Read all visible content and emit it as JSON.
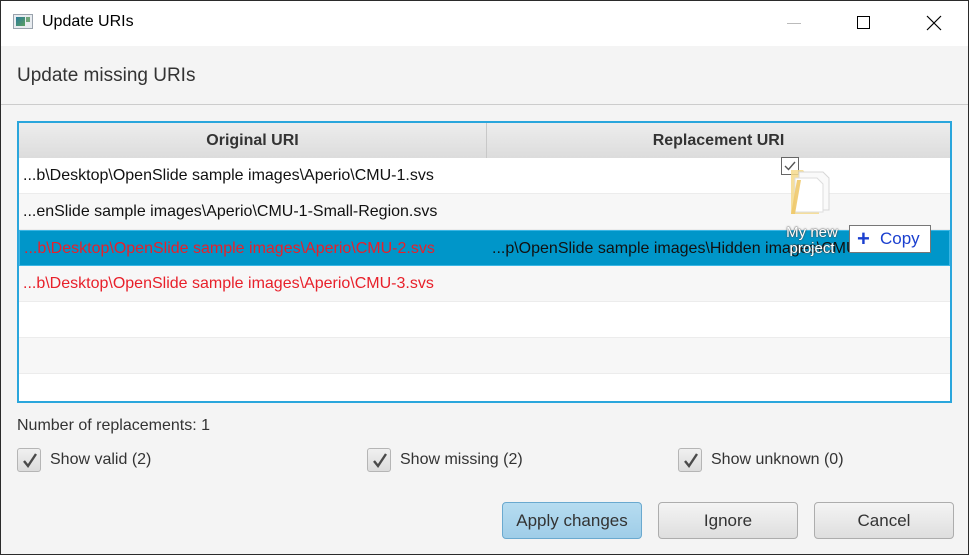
{
  "window": {
    "title": "Update URIs",
    "icon": "app-window-icon",
    "controls": {
      "minimize": "minimize-icon",
      "maximize": "maximize-icon",
      "close": "close-icon"
    }
  },
  "header": {
    "text": "Update missing URIs"
  },
  "table": {
    "columns": [
      "Original URI",
      "Replacement URI"
    ],
    "rows": [
      {
        "original": "...b\\Desktop\\OpenSlide sample images\\Aperio\\CMU-1.svs",
        "replacement": "",
        "status": "valid"
      },
      {
        "original": "...enSlide sample images\\Aperio\\CMU-1-Small-Region.svs",
        "replacement": "",
        "status": "valid"
      },
      {
        "original": "...b\\Desktop\\OpenSlide sample images\\Aperio\\CMU-2.svs",
        "replacement": "...p\\OpenSlide sample images\\Hidden images\\CMU-2.svs",
        "status": "missing",
        "selected": true
      },
      {
        "original": "...b\\Desktop\\OpenSlide sample images\\Aperio\\CMU-3.svs",
        "replacement": "",
        "status": "missing"
      },
      {
        "original": "",
        "replacement": ""
      },
      {
        "original": "",
        "replacement": ""
      },
      {
        "original": "",
        "replacement": ""
      }
    ],
    "colors": {
      "missing_text": "#e8202a",
      "selection": "#0096c9",
      "focus_border": "#2aa6dc"
    }
  },
  "drag_overlay": {
    "folder_label_line1": "My new",
    "folder_label_line2": "project",
    "copy_tooltip": "Copy",
    "copy_icon": "plus-icon"
  },
  "status": {
    "replacements": "Number of replacements: 1"
  },
  "filters": [
    {
      "label": "Show valid (2)",
      "checked": true
    },
    {
      "label": "Show missing (2)",
      "checked": true
    },
    {
      "label": "Show unknown (0)",
      "checked": true
    }
  ],
  "buttons": {
    "apply": "Apply changes",
    "ignore": "Ignore",
    "cancel": "Cancel"
  }
}
